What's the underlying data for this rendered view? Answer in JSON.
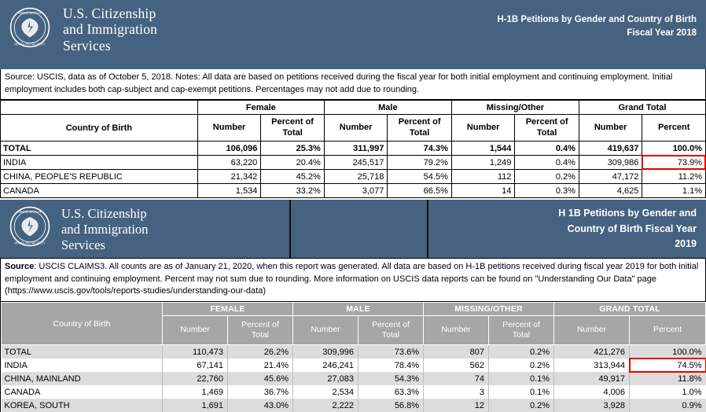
{
  "report1": {
    "agency": "U.S. Citizenship\nand Immigration\nServices",
    "seal_alt": "dhs-seal-icon",
    "title": "H-1B Petitions by Gender and Country of Birth\nFiscal Year 2018",
    "note": "Source: USCIS, data as of October 5, 2018. Notes:  All data are based on petitions received during the fiscal year for both initial employment and continuing employment. Initial employment includes both cap-subject and cap-exempt petitions. Percentages may not add due to rounding.",
    "table": {
      "groups": [
        "",
        "Female",
        "Male",
        "Missing/Other",
        "Grand Total"
      ],
      "col_country": "Country of Birth",
      "subheaders": [
        "Number",
        "Percent of\nTotal",
        "Number",
        "Percent of\nTotal",
        "Number",
        "Percent of\nTotal",
        "Number",
        "Percent"
      ],
      "rows": [
        {
          "country": "TOTAL",
          "female_n": "106,096",
          "female_p": "25.3%",
          "male_n": "311,997",
          "male_p": "74.3%",
          "missing_n": "1,544",
          "missing_p": "0.4%",
          "total_n": "419,637",
          "total_p": "100.0%"
        },
        {
          "country": "INDIA",
          "female_n": "63,220",
          "female_p": "20.4%",
          "male_n": "245,517",
          "male_p": "79.2%",
          "missing_n": "1,249",
          "missing_p": "0.4%",
          "total_n": "309,986",
          "total_p": "73.9%"
        },
        {
          "country": "CHINA, PEOPLE'S REPUBLIC",
          "female_n": "21,342",
          "female_p": "45.2%",
          "male_n": "25,718",
          "male_p": "54.5%",
          "missing_n": "112",
          "missing_p": "0.2%",
          "total_n": "47,172",
          "total_p": "11.2%"
        },
        {
          "country": "CANADA",
          "female_n": "1,534",
          "female_p": "33.2%",
          "male_n": "3,077",
          "male_p": "66.5%",
          "missing_n": "14",
          "missing_p": "0.3%",
          "total_n": "4,625",
          "total_p": "1.1%"
        }
      ]
    }
  },
  "report2": {
    "agency": "U.S. Citizenship\nand Immigration\nServices",
    "seal_alt": "dhs-seal-icon",
    "title": "H 1B Petitions by Gender and\nCountry of Birth Fiscal Year\n2019",
    "note_label": "Source",
    "note": ": USCIS CLAIMS3. All counts are as of January 21, 2020, when this report was generated. All data are based on H-1B petitions received during fiscal year 2019 for both initial employment and continuing employment. Percent may not sum due to rounding. More information on USCIS data reports can be found on \"Understanding Our Data\" page (https://www.uscis.gov/tools/reports-studies/understanding-our-data)",
    "table": {
      "groups": [
        "",
        "FEMALE",
        "MALE",
        "MISSING/OTHER",
        "GRAND TOTAL"
      ],
      "col_country": "Country of Birth",
      "subheaders": [
        "Number",
        "Percent of\nTotal",
        "Number",
        "Percent of\nTotal",
        "Number",
        "Percent of\nTotal",
        "Number",
        "Percent"
      ],
      "rows": [
        {
          "country": "TOTAL",
          "female_n": "110,473",
          "female_p": "26.2%",
          "male_n": "309,996",
          "male_p": "73.6%",
          "missing_n": "807",
          "missing_p": "0.2%",
          "total_n": "421,276",
          "total_p": "100.0%"
        },
        {
          "country": "INDIA",
          "female_n": "67,141",
          "female_p": "21.4%",
          "male_n": "246,241",
          "male_p": "78.4%",
          "missing_n": "562",
          "missing_p": "0.2%",
          "total_n": "313,944",
          "total_p": "74.5%"
        },
        {
          "country": "CHINA, MAINLAND",
          "female_n": "22,760",
          "female_p": "45.6%",
          "male_n": "27,083",
          "male_p": "54.3%",
          "missing_n": "74",
          "missing_p": "0.1%",
          "total_n": "49,917",
          "total_p": "11.8%"
        },
        {
          "country": "CANADA",
          "female_n": "1,469",
          "female_p": "36.7%",
          "male_n": "2,534",
          "male_p": "63.3%",
          "missing_n": "3",
          "missing_p": "0.1%",
          "total_n": "4,006",
          "total_p": "1.0%"
        },
        {
          "country": "KOREA, SOUTH",
          "female_n": "1,691",
          "female_p": "43.0%",
          "male_n": "2,222",
          "male_p": "56.8%",
          "missing_n": "12",
          "missing_p": "0.2%",
          "total_n": "3,928",
          "total_p": "0.9%"
        }
      ]
    }
  },
  "colors": {
    "banner_blue": "#456380",
    "header_gray": "#a6a6a6",
    "row_shade": "#dcdcdc",
    "highlight_red": "#e60000"
  }
}
